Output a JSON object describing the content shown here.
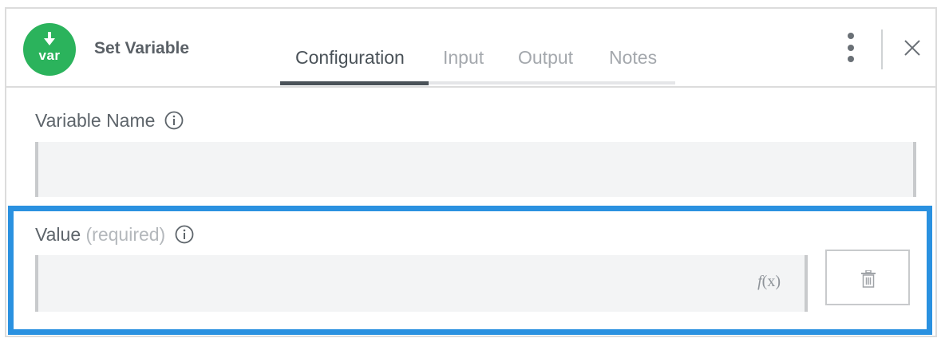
{
  "header": {
    "app_icon_text": "var",
    "title": "Set Variable",
    "tabs": [
      {
        "label": "Configuration",
        "active": true
      },
      {
        "label": "Input",
        "active": false
      },
      {
        "label": "Output",
        "active": false
      },
      {
        "label": "Notes",
        "active": false
      }
    ]
  },
  "fields": {
    "variable_name": {
      "label": "Variable Name",
      "value": ""
    },
    "value": {
      "label": "Value",
      "required_hint": "(required)",
      "value": "",
      "fx_label": "(x)",
      "fx_prefix": "f"
    }
  },
  "colors": {
    "accent_green": "#2bb35c",
    "highlight_blue": "#2a91e0",
    "active_tab": "#4a5258",
    "inactive_tab": "#a4a8ad"
  },
  "icons": [
    "download-arrow-icon",
    "more-vertical-icon",
    "close-icon",
    "info-icon",
    "function-icon",
    "trash-icon"
  ]
}
